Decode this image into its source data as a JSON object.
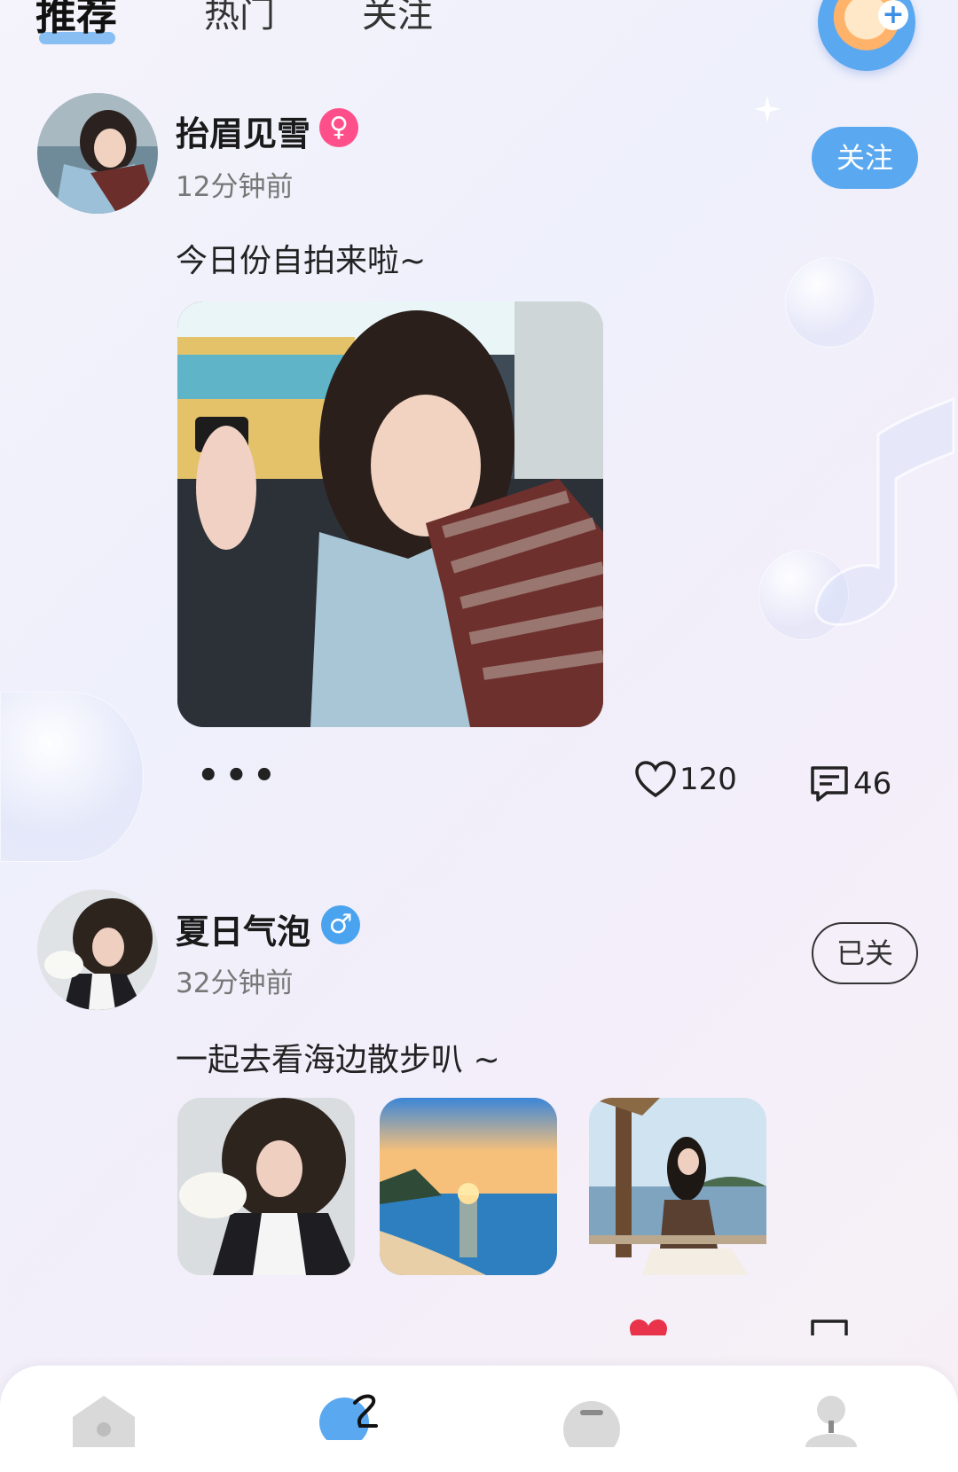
{
  "tabs": [
    {
      "label": "推荐",
      "active": true
    },
    {
      "label": "热门",
      "active": false
    },
    {
      "label": "关注",
      "active": false
    }
  ],
  "posts": [
    {
      "username": "抬眉见雪",
      "gender": "female",
      "gender_symbol": "♀",
      "gender_color": "#ff4f8a",
      "time": "12分钟前",
      "caption": "今日份自拍来啦~",
      "follow_label": "关注",
      "likes": "120",
      "comments": "46"
    },
    {
      "username": "夏日气泡",
      "gender": "male",
      "gender_symbol": "♂",
      "gender_color": "#4aa3ee",
      "time": "32分钟前",
      "caption": "一起去看海边散步叭 ~",
      "follow_label": "已关"
    }
  ],
  "colors": {
    "accent": "#5aa8f0",
    "like_red": "#e8334a"
  },
  "bottom_nav": [
    {
      "icon": "home-icon"
    },
    {
      "icon": "planet-icon"
    },
    {
      "icon": "message-icon"
    },
    {
      "icon": "profile-icon"
    }
  ]
}
